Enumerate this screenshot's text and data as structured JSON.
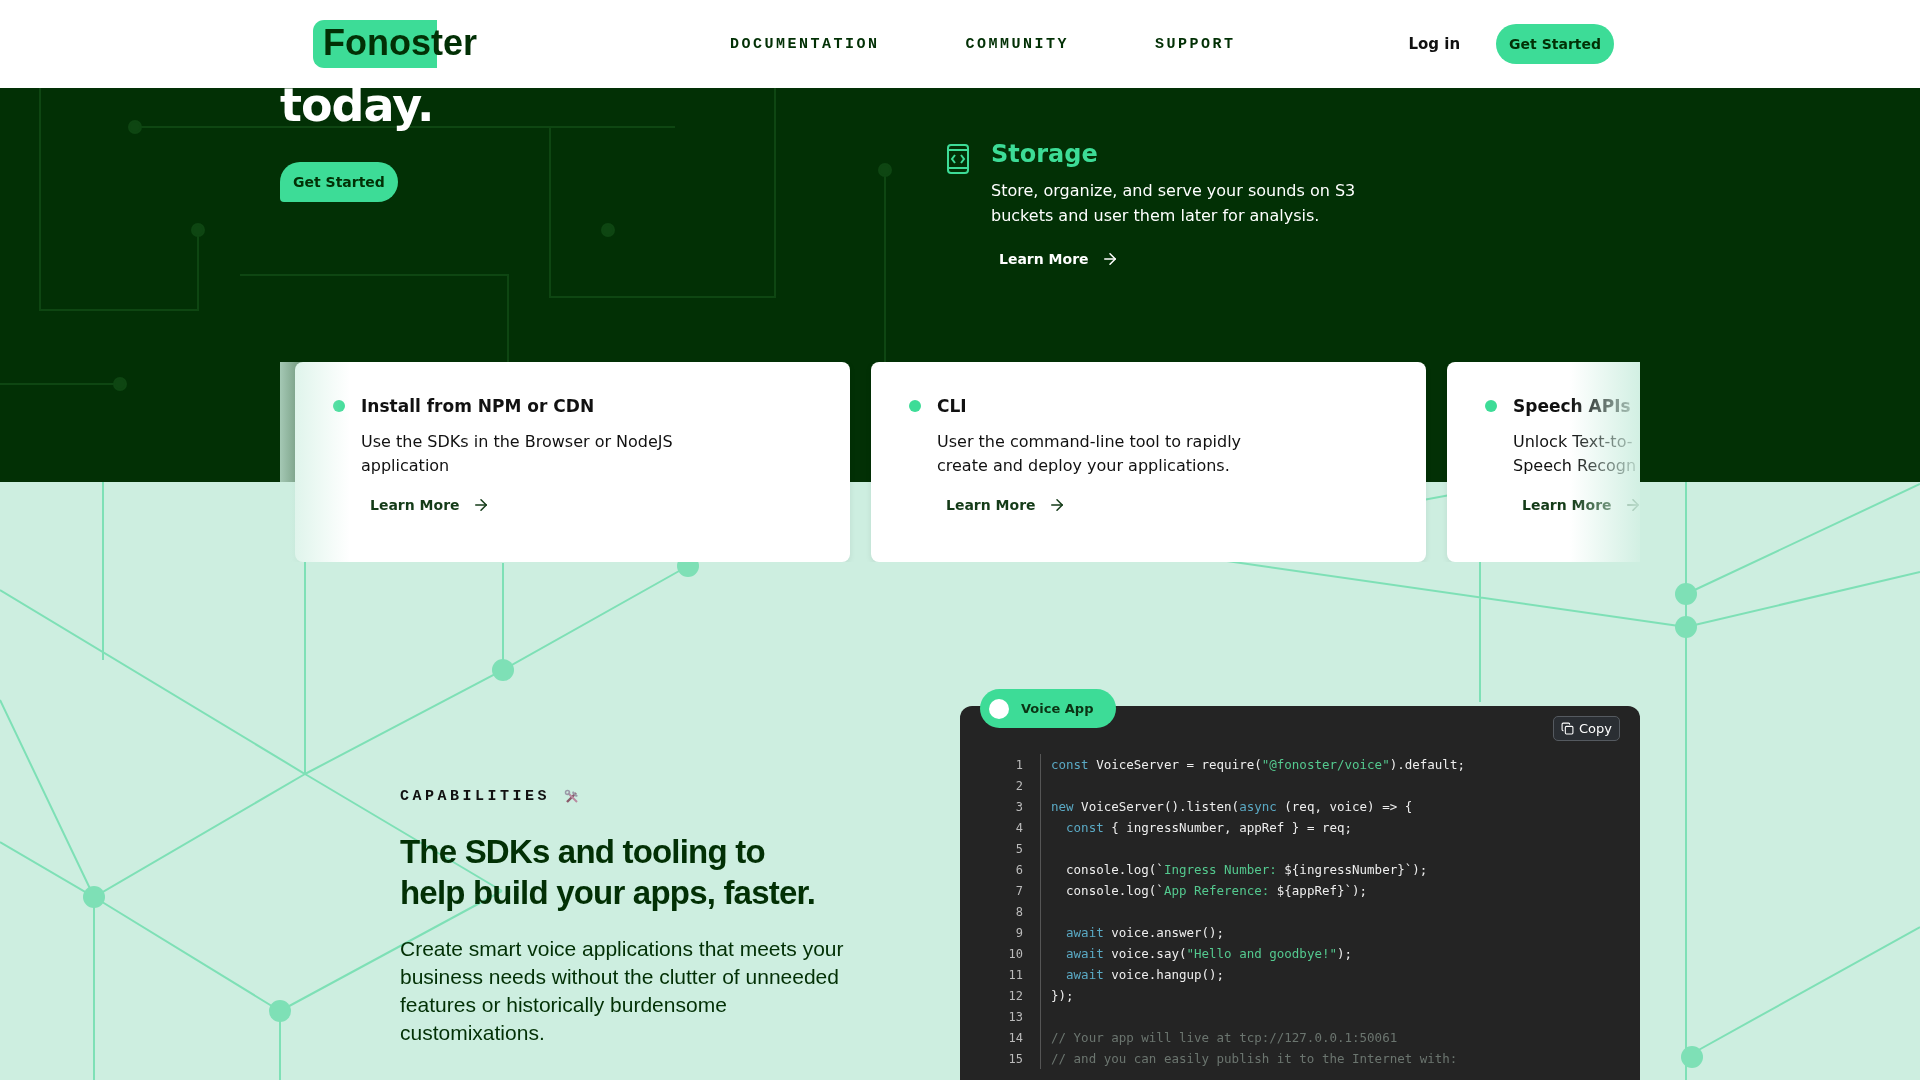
{
  "header": {
    "logo": "Fonoster",
    "nav": [
      "DOCUMENTATION",
      "COMMUNITY",
      "SUPPORT"
    ],
    "login": "Log in",
    "cta": "Get Started"
  },
  "hero": {
    "heading": "today.",
    "cta": "Get Started",
    "feature": {
      "title": "Storage",
      "description": "Store, organize, and serve your sounds on S3 buckets and user them later for analysis.",
      "link": "Learn More"
    }
  },
  "cards": [
    {
      "title": "Install from NPM or CDN",
      "description": "Use the SDKs in the Browser or NodeJS application",
      "link": "Learn More"
    },
    {
      "title": "CLI",
      "description": "User the command-line tool to rapidly create and deploy your applications.",
      "link": "Learn More"
    },
    {
      "title": "Speech APIs",
      "description": "Unlock Text-to-\nSpeech Recogn",
      "link": "Learn More"
    }
  ],
  "capabilities": {
    "eyebrow": "CAPABILITIES",
    "heading": "The SDKs and tooling to help build your apps, faster.",
    "body": "Create smart voice applications that meets your business needs without the clutter of unneeded features or historically burdensome customixations."
  },
  "code": {
    "tab": "Voice App",
    "copy": "Copy",
    "lines": [
      {
        "number": "1",
        "tokens": [
          {
            "kind": "keyword",
            "text": "const"
          },
          {
            "kind": "plain",
            "text": " VoiceServer = require("
          },
          {
            "kind": "string",
            "text": "\"@fonoster/voice\""
          },
          {
            "kind": "plain",
            "text": ").default;"
          }
        ]
      },
      {
        "number": "2"
      },
      {
        "number": "3",
        "tokens": [
          {
            "kind": "keyword",
            "text": "new"
          },
          {
            "kind": "plain",
            "text": " VoiceServer().listen("
          },
          {
            "kind": "keyword",
            "text": "async"
          },
          {
            "kind": "plain",
            "text": " (req, voice) => {"
          }
        ]
      },
      {
        "number": "4",
        "tokens": [
          {
            "kind": "keyword",
            "text": "  const"
          },
          {
            "kind": "plain",
            "text": " { ingressNumber, appRef } = req;"
          }
        ]
      },
      {
        "number": "5"
      },
      {
        "number": "6",
        "tokens": [
          {
            "kind": "plain",
            "text": "  console.log(`"
          },
          {
            "kind": "string",
            "text": "Ingress Number: "
          },
          {
            "kind": "plain",
            "text": "${ingressNumber}`);"
          }
        ]
      },
      {
        "number": "7",
        "tokens": [
          {
            "kind": "plain",
            "text": "  console.log(`"
          },
          {
            "kind": "string",
            "text": "App Reference: "
          },
          {
            "kind": "plain",
            "text": "${appRef}`);"
          }
        ]
      },
      {
        "number": "8"
      },
      {
        "number": "9",
        "tokens": [
          {
            "kind": "keyword",
            "text": "  await"
          },
          {
            "kind": "plain",
            "text": " voice.answer();"
          }
        ]
      },
      {
        "number": "10",
        "tokens": [
          {
            "kind": "keyword",
            "text": "  await"
          },
          {
            "kind": "plain",
            "text": " voice.say("
          },
          {
            "kind": "string",
            "text": "\"Hello and goodbye!\""
          },
          {
            "kind": "plain",
            "text": ");"
          }
        ]
      },
      {
        "number": "11",
        "tokens": [
          {
            "kind": "keyword",
            "text": "  await"
          },
          {
            "kind": "plain",
            "text": " voice.hangup();"
          }
        ]
      },
      {
        "number": "12",
        "tokens": [
          {
            "kind": "plain",
            "text": "});"
          }
        ]
      },
      {
        "number": "13"
      },
      {
        "number": "14",
        "tokens": [
          {
            "kind": "comment",
            "text": "// Your app will live at tcp://127.0.0.1:50061"
          }
        ]
      },
      {
        "number": "15",
        "tokens": [
          {
            "kind": "comment",
            "text": "// and you can easily publish it to the Internet with:"
          }
        ]
      }
    ]
  }
}
